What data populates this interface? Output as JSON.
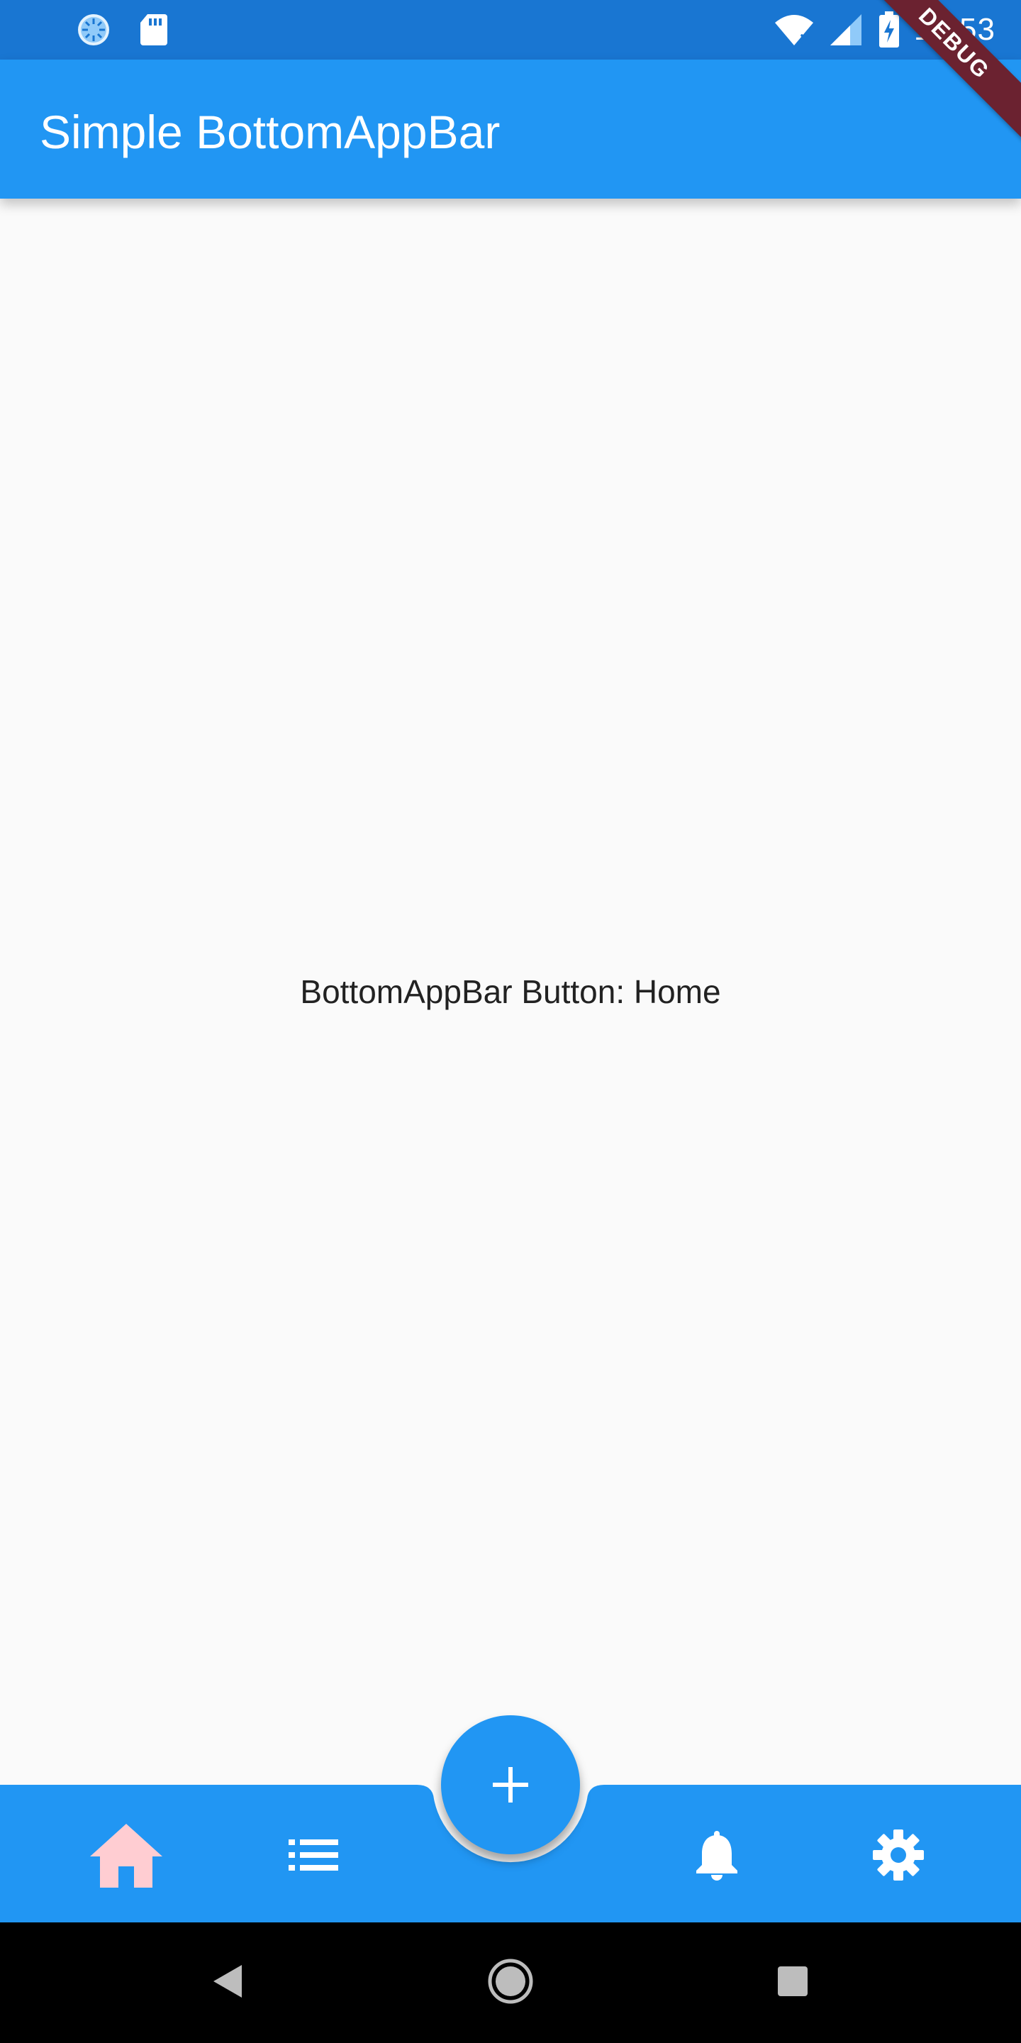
{
  "status_bar": {
    "time": "12:53",
    "icons": [
      "sync-icon",
      "sd-card-icon",
      "wifi-icon",
      "cell-signal-icon",
      "battery-charging-icon"
    ]
  },
  "app_bar": {
    "title": "Simple BottomAppBar"
  },
  "debug_banner": {
    "label": "DEBUG"
  },
  "body": {
    "message": "BottomAppBar Button: Home"
  },
  "bottom_bar": {
    "items": [
      {
        "name": "home",
        "icon": "home-icon",
        "selected": true
      },
      {
        "name": "list",
        "icon": "list-icon",
        "selected": false
      },
      {
        "name": "notifications",
        "icon": "bell-icon",
        "selected": false
      },
      {
        "name": "settings",
        "icon": "gear-icon",
        "selected": false
      }
    ],
    "fab_icon": "plus-icon"
  },
  "system_nav": {
    "buttons": [
      "back-icon",
      "home-circle-icon",
      "recents-icon"
    ]
  },
  "colors": {
    "primary": "#2196F3",
    "status_bar": "#1976D2",
    "selected_icon": "#FFCDD2",
    "icon": "#FFFFFF",
    "background": "#FAFAFA",
    "debug_banner": "#6B2230"
  }
}
